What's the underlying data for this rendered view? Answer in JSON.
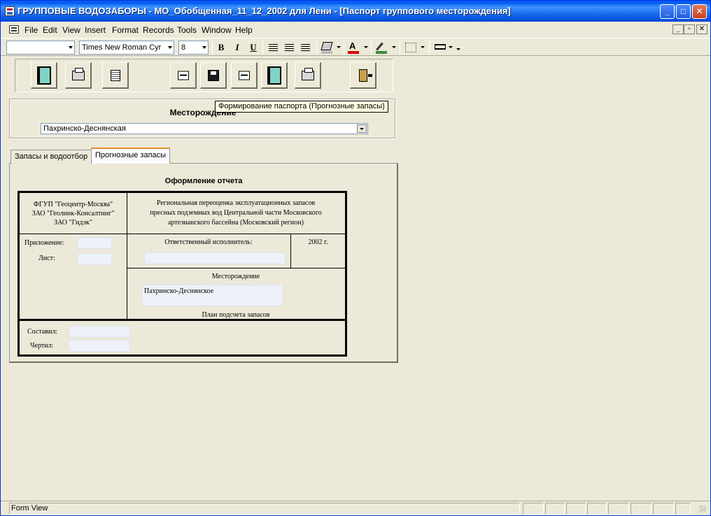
{
  "window": {
    "title": "ГРУППОВЫЕ ВОДОЗАБОРЫ - МО_Обобщенная_11_12_2002 для Лени - [Паспорт группового месторождения]",
    "icon": "access-app-icon",
    "controls": [
      "minimize-icon",
      "maximize-icon",
      "close-icon"
    ]
  },
  "menu": {
    "items": [
      "File",
      "Edit",
      "View",
      "Insert",
      "Format",
      "Records",
      "Tools",
      "Window",
      "Help"
    ],
    "mdi_controls": [
      "_",
      "▫",
      "✕"
    ]
  },
  "format_toolbar": {
    "object_combo": "",
    "font_name": "Times New Roman Cyr",
    "font_size": "8",
    "bold": "B",
    "italic": "I",
    "underline": "U"
  },
  "command_buttons": [
    {
      "icon": "book-icon"
    },
    {
      "icon": "printer-icon"
    },
    {
      "icon": "document-icon"
    },
    {
      "icon": "form-icon"
    },
    {
      "icon": "save-icon"
    },
    {
      "icon": "form-icon"
    },
    {
      "icon": "book-icon"
    },
    {
      "icon": "printer-icon"
    },
    {
      "icon": "exit-door-icon"
    }
  ],
  "tooltip": "Формирование паспорта (Прогнозные запасы)",
  "deposit": {
    "label": "Месторождение",
    "value": "Пахринско-Деснянская"
  },
  "tabs": [
    {
      "label": "Запасы и водоотбор",
      "active": false
    },
    {
      "label": "Прогнозные запасы",
      "active": true
    }
  ],
  "report": {
    "title": "Оформление отчета",
    "org_lines": [
      "ФГУП \"Геоцентр-Москва\"",
      "ЗАО \"Геолинк-Консалтинг\"",
      "ЗАО \"Гидэк\""
    ],
    "desc_lines": [
      "Региональная переоценка эксплуатационных запасов",
      "пресных подземных вод Центральной части Московского",
      "артезианского бассейна (Московский регион)"
    ],
    "appendix_label": "Приложение:",
    "appendix_value": "",
    "sheet_label": "Лист:",
    "sheet_value": "",
    "responsible_label": "Ответственный исполнитель:",
    "responsible_value": "",
    "year": "2002 г.",
    "deposit_label": "Месторождение",
    "deposit_value": "Пахринско-Деснянское",
    "plan_label": "План подсчета запасов",
    "compiled_label": "Составил:",
    "compiled_value": "",
    "drawn_label": "Чертил:",
    "drawn_value": ""
  },
  "status": {
    "text": "Form View"
  }
}
